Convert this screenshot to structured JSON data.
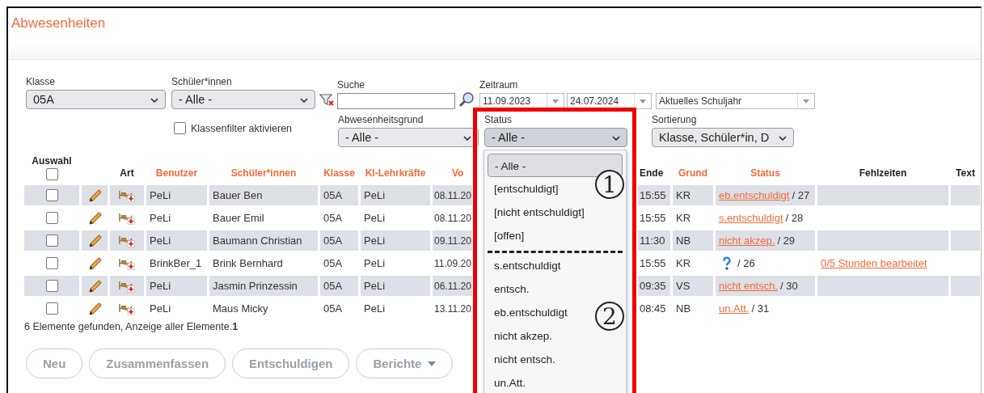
{
  "window": {
    "title": "Abwesenheiten"
  },
  "filters": {
    "klasse": {
      "label": "Klasse",
      "value": "05A"
    },
    "schueler": {
      "label": "Schüler*innen",
      "value": "- Alle -"
    },
    "suche": {
      "label": "Suche"
    },
    "zeitraum": {
      "label": "Zeitraum",
      "from": "11.09.2023",
      "to": "24.07.2024",
      "preset": "Aktuelles Schuljahr"
    },
    "klassenfilter": {
      "label": "Klassenfilter aktivieren",
      "checked": false
    },
    "grund": {
      "label": "Abwesenheitsgrund",
      "value": "- Alle -"
    },
    "status": {
      "label": "Status",
      "value": "- Alle -",
      "expanded": true,
      "option_groups": [
        {
          "marker": "1",
          "options": [
            {
              "label": "- Alle -",
              "selected": true
            },
            {
              "label": "[entschuldigt]",
              "selected": false
            },
            {
              "label": "[nicht entschuldigt]",
              "selected": false
            },
            {
              "label": "[offen]",
              "selected": false
            }
          ]
        },
        {
          "marker": "2",
          "options": [
            {
              "label": "s.entschuldigt",
              "selected": false
            },
            {
              "label": "entsch.",
              "selected": false
            },
            {
              "label": "eb.entschuldigt",
              "selected": false
            },
            {
              "label": "nicht akzep.",
              "selected": false
            },
            {
              "label": "nicht entsch.",
              "selected": false
            },
            {
              "label": "un.Att.",
              "selected": false
            }
          ]
        }
      ]
    },
    "sortierung": {
      "label": "Sortierung",
      "value": "Klasse, Schüler*in, D"
    }
  },
  "table": {
    "select_all": {
      "label": "Auswahl",
      "checked": false
    },
    "columns": [
      {
        "label": "Art",
        "sortable": false
      },
      {
        "label": "Benutzer",
        "sortable": true
      },
      {
        "label": "Schüler*innen",
        "sortable": true
      },
      {
        "label": "Klasse",
        "sortable": true
      },
      {
        "label": "Kl-Lehrkräfte",
        "sortable": true
      },
      {
        "label": "Vo",
        "sortable": true
      },
      {
        "label": "Ende",
        "sortable": false
      },
      {
        "label": "Grund",
        "sortable": true
      },
      {
        "label": "Status",
        "sortable": true
      },
      {
        "label": "Fehlzeiten",
        "sortable": false
      },
      {
        "label": "Text",
        "sortable": false
      }
    ],
    "rows": [
      {
        "checked": false,
        "benutzer": "PeLi",
        "schueler": "Bauer Ben",
        "klasse": "05A",
        "kl": "PeLi",
        "von": "08.11.20",
        "ende": "15:55",
        "grund": "KR",
        "status": {
          "kind": "link",
          "text": "eb.entschuldigt",
          "count": "/ 27"
        }
      },
      {
        "checked": false,
        "benutzer": "PeLi",
        "schueler": "Bauer Emil",
        "klasse": "05A",
        "kl": "PeLi",
        "von": "08.11.20",
        "ende": "15:55",
        "grund": "KR",
        "status": {
          "kind": "link",
          "text": "s.entschuldigt",
          "count": "/ 28"
        }
      },
      {
        "checked": false,
        "benutzer": "PeLi",
        "schueler": "Baumann Christian",
        "klasse": "05A",
        "kl": "PeLi",
        "von": "09.11.20",
        "ende": "11:30",
        "grund": "NB",
        "status": {
          "kind": "link",
          "text": "nicht akzep.",
          "count": "/ 29"
        }
      },
      {
        "checked": false,
        "benutzer": "BrinkBer_1",
        "schueler": "Brink Bernhard",
        "klasse": "05A",
        "kl": "PeLi",
        "von": "11.09.20",
        "ende": "15:55",
        "grund": "KR",
        "status": {
          "kind": "unknown",
          "count": "/ 26"
        },
        "fehlzeiten": "0/5 Stunden bearbeitet"
      },
      {
        "checked": false,
        "benutzer": "PeLi",
        "schueler": "Jasmin Prinzessin",
        "klasse": "05A",
        "kl": "PeLi",
        "von": "06.11.20",
        "ende": "09:35",
        "grund": "VS",
        "status": {
          "kind": "link",
          "text": "nicht entsch.",
          "count": "/ 30"
        }
      },
      {
        "checked": false,
        "benutzer": "PeLi",
        "schueler": "Maus Micky",
        "klasse": "05A",
        "kl": "PeLi",
        "von": "13.11.20",
        "ende": "08:45",
        "grund": "NB",
        "status": {
          "kind": "link",
          "text": "un.Att.",
          "count": "/ 31"
        }
      }
    ],
    "footer": "6 Elemente gefunden, Anzeige aller Elemente.**1**"
  },
  "buttons": [
    {
      "label": "Neu",
      "kind": "plain",
      "disabled": true
    },
    {
      "label": "Zusammenfassen",
      "kind": "plain",
      "disabled": true
    },
    {
      "label": "Entschuldigen",
      "kind": "plain",
      "disabled": true
    },
    {
      "label": "Berichte",
      "kind": "dropdown",
      "disabled": true
    }
  ]
}
